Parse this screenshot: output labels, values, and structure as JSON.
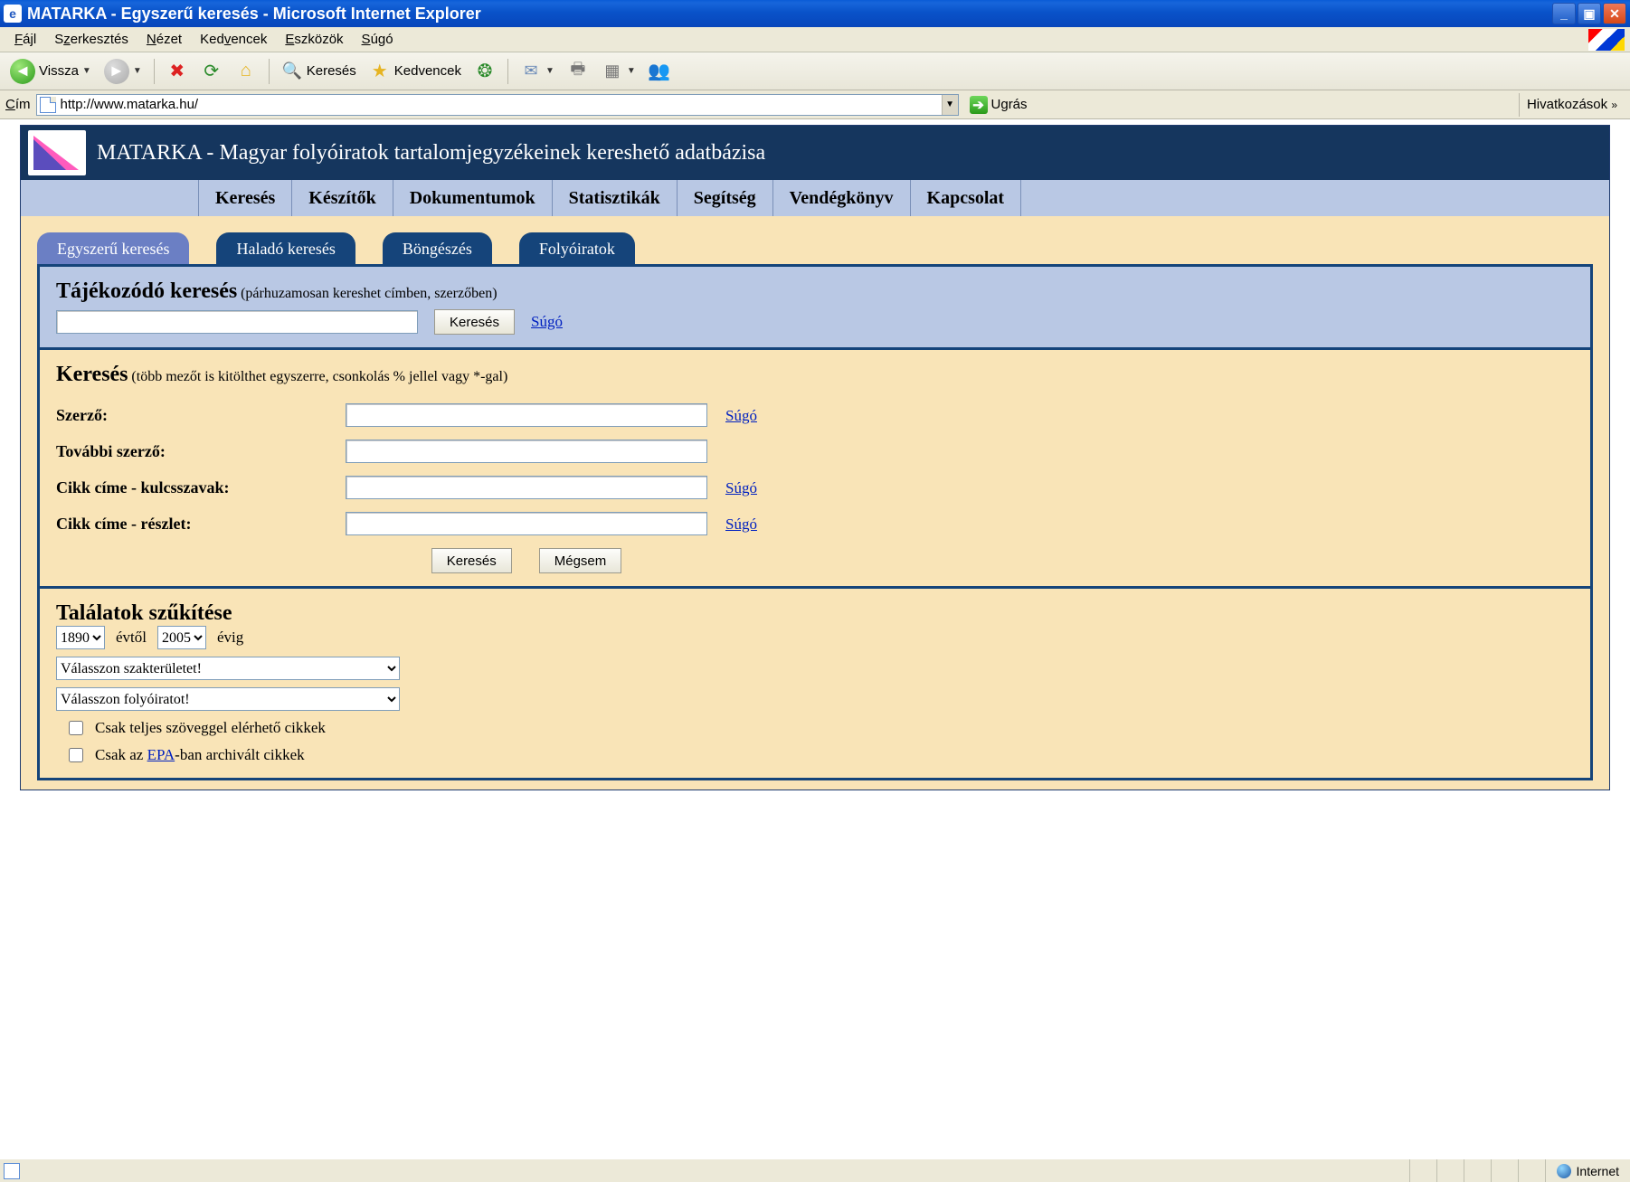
{
  "window": {
    "title": "MATARKA - Egyszerű keresés - Microsoft Internet Explorer"
  },
  "menubar": {
    "items": [
      "Fájl",
      "Szerkesztés",
      "Nézet",
      "Kedvencek",
      "Eszközök",
      "Súgó"
    ]
  },
  "toolbar": {
    "back": "Vissza",
    "search": "Keresés",
    "favorites": "Kedvencek"
  },
  "addressbar": {
    "label": "Cím",
    "url": "http://www.matarka.hu/",
    "go": "Ugrás",
    "links": "Hivatkozások"
  },
  "page": {
    "header_title": "MATARKA - Magyar folyóiratok tartalomjegyzékeinek kereshető adatbázisa",
    "nav": [
      "Keresés",
      "Készítők",
      "Dokumentumok",
      "Statisztikák",
      "Segítség",
      "Vendégkönyv",
      "Kapcsolat"
    ],
    "tabs": [
      "Egyszerű keresés",
      "Haladó keresés",
      "Böngészés",
      "Folyóiratok"
    ],
    "quick": {
      "title": "Tájékozódó keresés",
      "hint": "(párhuzamosan kereshet címben, szerzőben)",
      "button": "Keresés",
      "help": "Súgó"
    },
    "search": {
      "title": "Keresés",
      "hint": "(több mezőt is kitölthet egyszerre, csonkolás % jellel vagy *-gal)",
      "fields": {
        "author": "Szerző:",
        "more_author": "További szerző:",
        "title_keywords": "Cikk címe - kulcsszavak:",
        "title_snippet": "Cikk címe - részlet:"
      },
      "help": "Súgó",
      "submit": "Keresés",
      "cancel": "Mégsem"
    },
    "filter": {
      "title": "Találatok szűkítése",
      "year_from": "1890",
      "year_from_label": "évtől",
      "year_to": "2005",
      "year_to_label": "évig",
      "subject_placeholder": "Válasszon szakterületet!",
      "journal_placeholder": "Válasszon folyóiratot!",
      "fulltext": "Csak teljes szöveggel elérhető cikkek",
      "epa_prefix": "Csak az ",
      "epa_link": "EPA",
      "epa_suffix": "-ban archivált cikkek"
    }
  },
  "statusbar": {
    "zone": "Internet"
  }
}
